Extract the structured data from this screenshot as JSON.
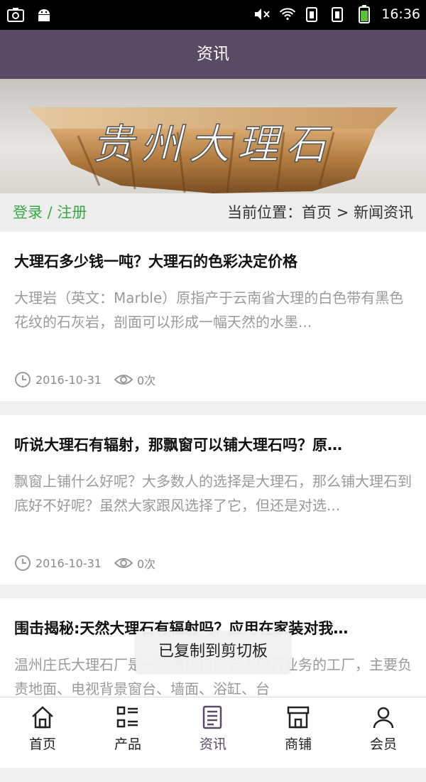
{
  "status": {
    "time": "16:36"
  },
  "header": {
    "title": "资讯"
  },
  "banner": {
    "text": "贵州大理石"
  },
  "infobar": {
    "login": "登录 / 注册",
    "location": "当前位置：首页 > 新闻资讯"
  },
  "articles": [
    {
      "title": "大理石多少钱一吨？大理石的色彩决定价格",
      "desc": "大理岩（英文：Marble）原指产于云南省大理的白色带有黑色花纹的石灰岩，剖面可以形成一幅天然的水墨...",
      "date": "2016-10-31",
      "views": "0次"
    },
    {
      "title": "听说大理石有辐射，那飘窗可以铺大理石吗？原…",
      "desc": "飘窗上铺什么好呢？大多数人的选择是大理石，那么铺大理石到底好不好呢？虽然大家跟风选择了它，但还是对选...",
      "date": "2016-10-31",
      "views": "0次"
    },
    {
      "title": "围击揭秘:天然大理石有辐射吗？应用在家装对我…",
      "desc": "温州庄氏大理石厂是一家承接精家装大理石业务的工厂，主要负责地面、电视背景窗台、墙面、浴缸、台",
      "date": "",
      "views": ""
    }
  ],
  "toast": {
    "text": "已复制到剪切板"
  },
  "tabbar": {
    "items": [
      {
        "label": "首页",
        "icon": "home-icon"
      },
      {
        "label": "产品",
        "icon": "list-icon"
      },
      {
        "label": "资讯",
        "icon": "news-icon"
      },
      {
        "label": "商铺",
        "icon": "shop-icon"
      },
      {
        "label": "会员",
        "icon": "user-icon"
      }
    ],
    "active_index": 2
  },
  "colors": {
    "header_bg": "#5b4a64",
    "login_green": "#38a845",
    "active_tab": "#5b4a64"
  }
}
